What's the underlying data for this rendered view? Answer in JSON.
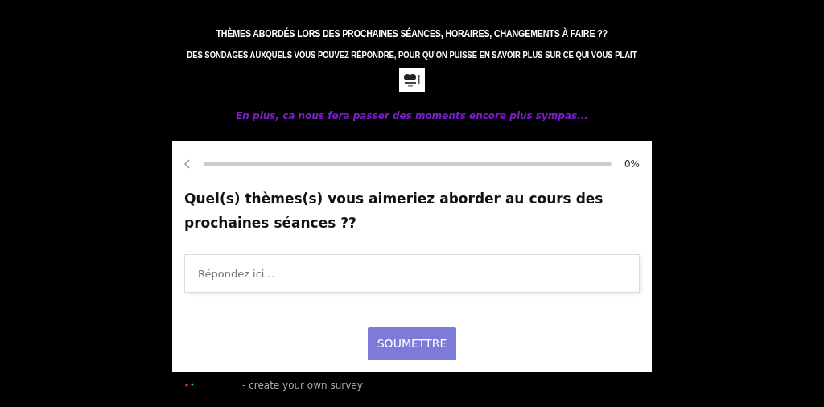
{
  "header": {
    "title": "THÈMES ABORDÉS LORS DES PROCHAINES SÉANCES, HORAIRES, CHANGEMENTS À FAIRE ??",
    "subtitle": "DES SONDAGES AUXQUELS VOUS POUVEZ RÉPONDRE, POUR QU’ON PUISSE EN SAVOIR PLUS SUR CE QUI VOUS PLAIT",
    "tagline": "En plus, ça nous fera passer des moments encore plus sympas..."
  },
  "survey": {
    "progress": {
      "level": 0,
      "reading": "0%"
    },
    "question": "Quel(s) thèmes(s) vous aimeriez aborder au cours des prochaines séances ??",
    "answer": {
      "placeholder": "Répondez ici..."
    },
    "submit": "SOUMETTRE"
  },
  "footer": {
    "text": "- create your own survey"
  }
}
